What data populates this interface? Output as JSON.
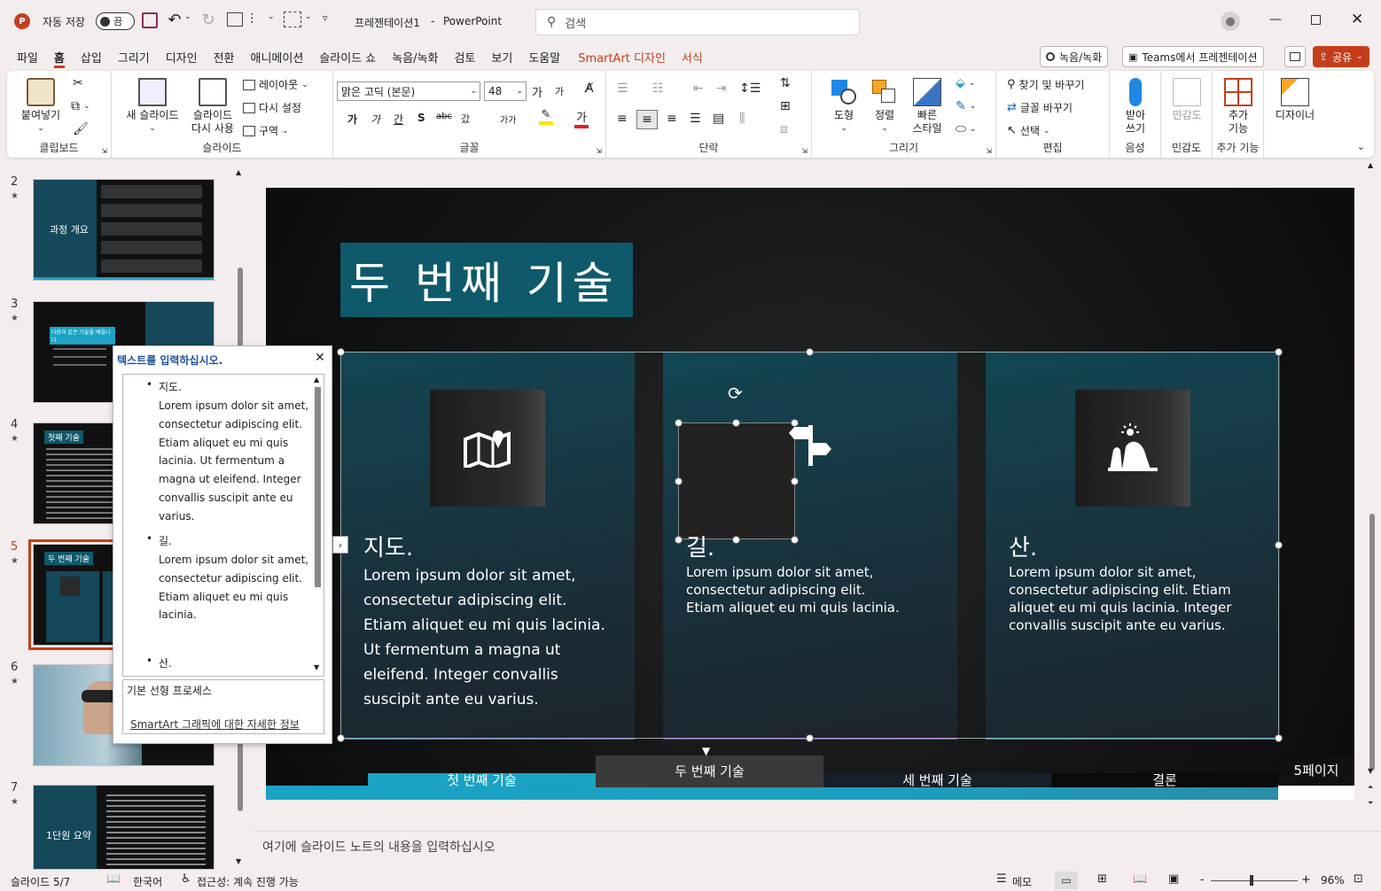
{
  "titlebar": {
    "autosave_label": "자동 저장",
    "autosave_state": "끔",
    "doc_title": "프레젠테이션1",
    "app_name": "PowerPoint",
    "separator": "-",
    "search_placeholder": "검색"
  },
  "menu": {
    "tabs": [
      "파일",
      "홈",
      "삽입",
      "그리기",
      "디자인",
      "전환",
      "애니메이션",
      "슬라이드 쇼",
      "녹음/녹화",
      "검토",
      "보기",
      "도움말",
      "SmartArt 디자인",
      "서식"
    ],
    "active": "홈",
    "record_button": "녹음/녹화",
    "teams_button": "Teams에서 프레젠테이션",
    "share_button": "공유"
  },
  "ribbon": {
    "clipboard": {
      "paste": "붙여넣기",
      "label": "클립보드"
    },
    "slides": {
      "new_slide": "새 슬라이드",
      "reuse_1": "슬라이드",
      "reuse_2": "다시 사용",
      "layout": "레이아웃",
      "reset": "다시 설정",
      "section": "구역",
      "label": "슬라이드"
    },
    "font": {
      "name": "맑은 고딕 (본문)",
      "size": "48",
      "label": "글꼴",
      "bold": "가",
      "italic": "가",
      "underline": "간",
      "shadow": "S",
      "strike": "abc",
      "spacing": "갔",
      "case": "가가",
      "grow": "가",
      "shrink": "가"
    },
    "paragraph": {
      "label": "단락"
    },
    "drawing": {
      "shapes": "도형",
      "arrange": "정렬",
      "quick_1": "빠른",
      "quick_2": "스타일",
      "label": "그리기"
    },
    "editing": {
      "find": "찾기 및 바꾸기",
      "replace": "글꼴 바꾸기",
      "select": "선택",
      "label": "편집"
    },
    "voice": {
      "dictate_1": "받아",
      "dictate_2": "쓰기",
      "label": "음성"
    },
    "sensitivity": {
      "btn": "민감도",
      "label": "민감도"
    },
    "addins": {
      "btn_1": "추가",
      "btn_2": "기능",
      "label": "추가 기능"
    },
    "designer": {
      "btn": "디자이너"
    }
  },
  "thumbnails": [
    {
      "num": "2",
      "star": "★",
      "title": "과정 개요"
    },
    {
      "num": "3",
      "star": "★",
      "title": "다음과 같은 기술을 배웁니다."
    },
    {
      "num": "4",
      "star": "★",
      "title": "첫째 기술"
    },
    {
      "num": "5",
      "star": "★",
      "title": "두 번째 기술"
    },
    {
      "num": "6",
      "star": "★",
      "title": ""
    },
    {
      "num": "7",
      "star": "★",
      "title": "1단원 요약"
    }
  ],
  "text_pane": {
    "title": "텍스트를 입력하십시오.",
    "items": [
      {
        "head": "지도.",
        "body": [
          "Lorem ipsum dolor sit amet,",
          "consectetur adipiscing elit.",
          "Etiam aliquet eu mi quis",
          "lacinia. Ut fermentum a",
          "magna ut eleifend. Integer",
          "convallis suscipit ante eu",
          "varius."
        ]
      },
      {
        "head": "길.",
        "body": [
          "Lorem ipsum dolor sit amet,",
          "consectetur adipiscing elit.",
          "Etiam aliquet eu mi quis",
          "lacinia."
        ]
      },
      {
        "head": "산.",
        "body": []
      }
    ],
    "layout_name": "기본 선형 프로세스",
    "more_info": "SmartArt 그래픽에 대한 자세한 정보"
  },
  "slide": {
    "title": "두 번째 기술",
    "cards": [
      {
        "title": "지도.",
        "body": "Lorem ipsum dolor sit amet, consectetur adipiscing elit. Etiam aliquet eu mi quis lacinia. Ut fermentum a magna ut eleifend. Integer convallis suscipit ante eu varius.",
        "icon": "map-pin-icon"
      },
      {
        "title": "길.",
        "body": "Lorem ipsum dolor sit amet, consectetur adipiscing elit. Etiam aliquet eu mi quis lacinia.",
        "icon": "signpost-icon"
      },
      {
        "title": "산.",
        "body": "Lorem ipsum dolor sit amet, consectetur adipiscing elit. Etiam aliquet eu mi quis lacinia. Integer convallis suscipit ante eu varius.",
        "icon": "mountain-sun-icon"
      }
    ],
    "nav_tabs": [
      "첫 번째 기술",
      "두 번째 기술",
      "세 번째 기술",
      "결론"
    ],
    "page_label": "5페이지",
    "accent": "#1aa3c4",
    "title_bg": "#0e5a6a"
  },
  "notes": {
    "placeholder": "여기에 슬라이드 노트의 내용을 입력하십시오"
  },
  "status": {
    "slide_pos": "슬라이드 5/7",
    "language": "한국어",
    "accessibility": "접근성: 계속 진행 가능",
    "notes_btn": "메모",
    "zoom": "96%",
    "minus": "-",
    "plus": "+"
  }
}
